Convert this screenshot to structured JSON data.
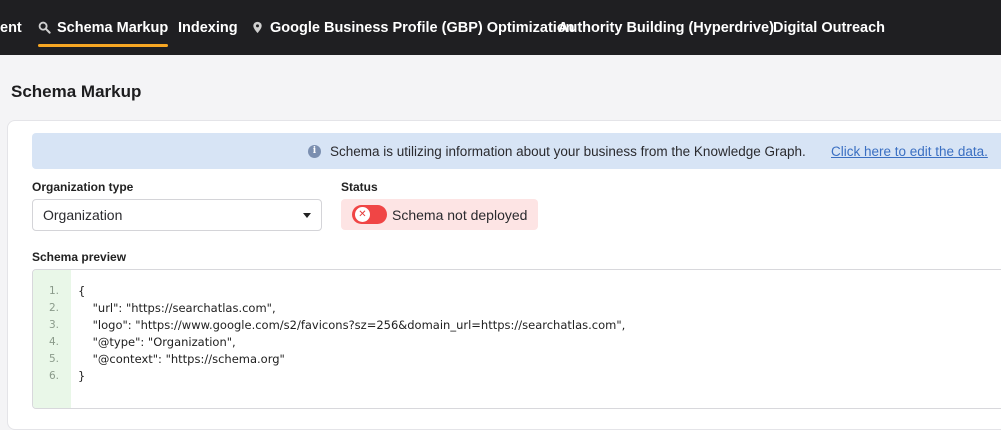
{
  "nav": {
    "items": [
      {
        "label": "ent"
      },
      {
        "label": "Schema Markup",
        "icon": "search-icon"
      },
      {
        "label": "Indexing"
      },
      {
        "label": "Google Business Profile (GBP) Optimization",
        "icon": "location-pin-icon"
      },
      {
        "label": "Authority Building (Hyperdrive)"
      },
      {
        "label": "Digital Outreach"
      }
    ],
    "accent": "#f6a623"
  },
  "page": {
    "title": "Schema Markup"
  },
  "banner": {
    "icon": "info-icon",
    "text": "Schema is utilizing information about your business from the Knowledge Graph.",
    "link": "Click here to edit the data."
  },
  "organization": {
    "label": "Organization type",
    "value": "Organization"
  },
  "status": {
    "label": "Status",
    "text": "Schema not deployed",
    "toggle_color": "#f04545"
  },
  "preview": {
    "label": "Schema preview",
    "lines": [
      {
        "no": "1.",
        "code": "{"
      },
      {
        "no": "2.",
        "code": "    \"url\": \"https://searchatlas.com\","
      },
      {
        "no": "3.",
        "code": "    \"logo\": \"https://www.google.com/s2/favicons?sz=256&domain_url=https://searchatlas.com\","
      },
      {
        "no": "4.",
        "code": "    \"@type\": \"Organization\","
      },
      {
        "no": "5.",
        "code": "    \"@context\": \"https://schema.org\""
      },
      {
        "no": "6.",
        "code": "}"
      }
    ]
  }
}
